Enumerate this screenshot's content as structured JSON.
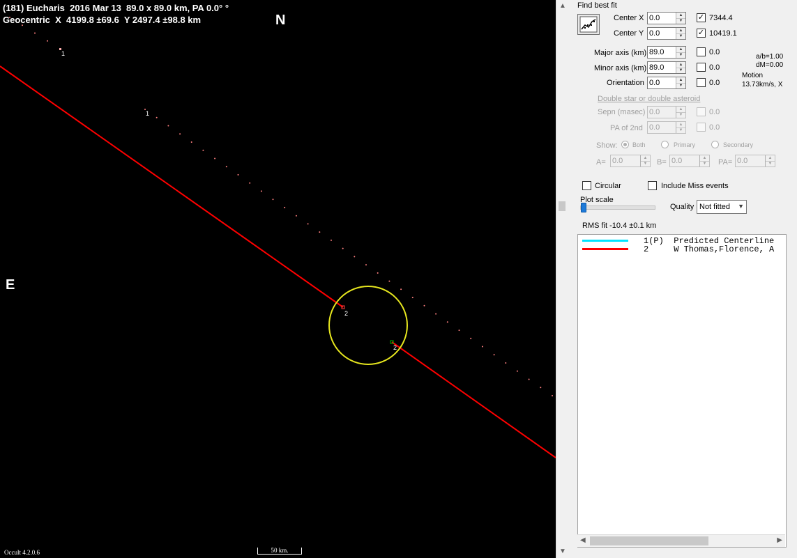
{
  "plot": {
    "title_line1": "(181) Eucharis  2016 Mar 13  89.0 x 89.0 km, PA 0.0° °",
    "title_line2": "Geocentric  X  4199.8 ±69.6  Y 2497.4 ±98.8 km",
    "north_label": "N",
    "east_label": "E",
    "version": "Occult 4.2.0.6",
    "scale_label": "50 km.",
    "chord_labels": [
      "1",
      "1",
      "2",
      "2"
    ],
    "colors": {
      "background": "#000000",
      "chord": "#ff0000",
      "ellipse": "#e6e61e",
      "dots": "#ff8080",
      "reappear": "#00c000"
    }
  },
  "panel": {
    "find_best_fit": "Find best fit",
    "center_x_label": "Center X",
    "center_x_value": "0.0",
    "center_x_check_value": "7344.4",
    "center_y_label": "Center Y",
    "center_y_value": "0.0",
    "center_y_check_value": "10419.1",
    "major_axis_label": "Major axis (km)",
    "major_axis_value": "89.0",
    "major_axis_check_value": "0.0",
    "minor_axis_label": "Minor axis (km)",
    "minor_axis_value": "89.0",
    "minor_axis_check_value": "0.0",
    "orientation_label": "Orientation",
    "orientation_value": "0.0",
    "orientation_check_value": "0.0",
    "ab_ratio": "a/b=1.00",
    "dm": "dM=0.00",
    "motion_label": "Motion",
    "motion_value": "13.73km/s, X",
    "double_star_link": "Double star  or  double asteroid",
    "sepn_label": "Sepn (masec)",
    "sepn_value": "0.0",
    "sepn_check_value": "0.0",
    "pa2nd_label": "PA of 2nd",
    "pa2nd_value": "0.0",
    "pa2nd_check_value": "0.0",
    "show_label": "Show:",
    "radio_both": "Both",
    "radio_primary": "Primary",
    "radio_secondary": "Secondary",
    "a_label": "A=",
    "a_value": "0.0",
    "b_label": "B=",
    "b_value": "0.0",
    "pa_label": "PA=",
    "pa_value": "0.0",
    "circular_label": "Circular",
    "include_miss_label": "Include Miss events",
    "plot_scale_label": "Plot scale",
    "quality_label": "Quality",
    "quality_value": "Not fitted",
    "rms_fit": "RMS fit -10.4 ±0.1 km",
    "legend": [
      {
        "id": "1(P)",
        "text": "1(P)  Predicted Centerline",
        "color": "#00e5ff"
      },
      {
        "id": "2",
        "text": "2     W Thomas,Florence, A",
        "color": "#ff0000"
      }
    ]
  }
}
